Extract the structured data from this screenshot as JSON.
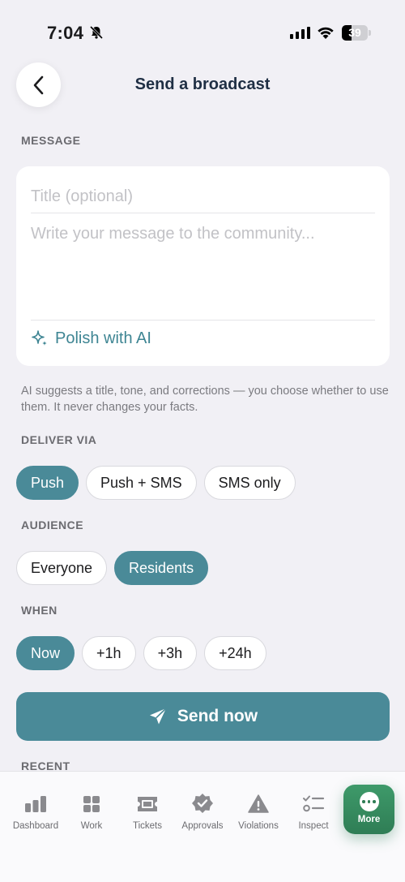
{
  "status_bar": {
    "time": "7:04",
    "battery_level": "39"
  },
  "header": {
    "title": "Send a broadcast",
    "back_icon": "chevron-left-icon"
  },
  "message": {
    "section_label": "MESSAGE",
    "title_placeholder": "Title (optional)",
    "body_placeholder": "Write your message to the community...",
    "polish_label": "Polish with AI",
    "polish_icon": "sparkle-icon",
    "helper_text": "AI suggests a title, tone, and corrections — you choose whether to use them. It never changes your facts."
  },
  "deliver_via": {
    "section_label": "DELIVER VIA",
    "options": [
      "Push",
      "Push + SMS",
      "SMS only"
    ],
    "selected": "Push"
  },
  "audience": {
    "section_label": "AUDIENCE",
    "options": [
      "Everyone",
      "Residents"
    ],
    "selected": "Residents"
  },
  "when": {
    "section_label": "WHEN",
    "options": [
      "Now",
      "+1h",
      "+3h",
      "+24h"
    ],
    "selected": "Now"
  },
  "send_button": {
    "label": "Send now",
    "icon": "paper-plane-icon"
  },
  "recent": {
    "section_label": "RECENT"
  },
  "tab_bar": {
    "items": [
      {
        "label": "Dashboard",
        "icon": "bar-chart-icon"
      },
      {
        "label": "Work",
        "icon": "grid-icon"
      },
      {
        "label": "Tickets",
        "icon": "ticket-icon"
      },
      {
        "label": "Approvals",
        "icon": "badge-check-icon"
      },
      {
        "label": "Violations",
        "icon": "warning-icon"
      },
      {
        "label": "Inspect",
        "icon": "checklist-icon"
      },
      {
        "label": "More",
        "icon": "more-icon"
      }
    ],
    "active": "More"
  },
  "colors": {
    "accent": "#4a8a98",
    "more_tab": "#2f7d55",
    "title": "#1f2f44"
  }
}
